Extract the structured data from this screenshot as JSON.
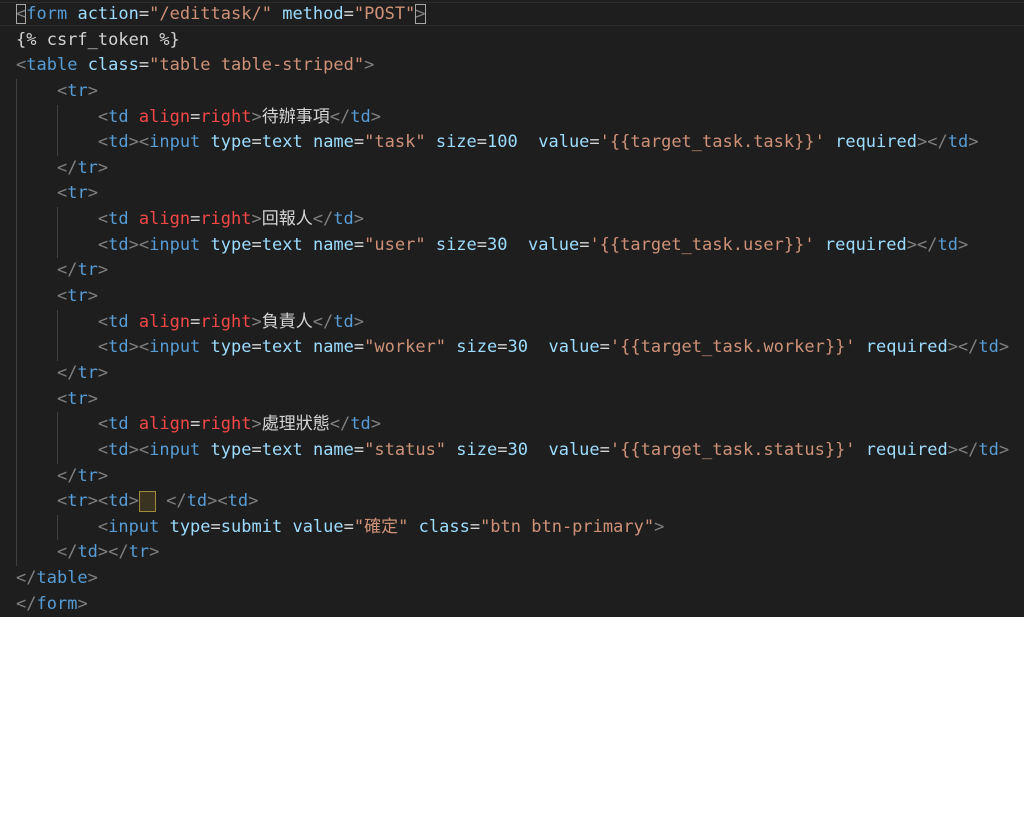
{
  "editor": {
    "lines": [
      [
        [
          "punct",
          "<"
        ],
        [
          "tag",
          "form"
        ],
        [
          "text",
          " "
        ],
        [
          "attr",
          "action"
        ],
        [
          "eq",
          "="
        ],
        [
          "str",
          "\"/edittask/\""
        ],
        [
          "text",
          " "
        ],
        [
          "attr",
          "method"
        ],
        [
          "eq",
          "="
        ],
        [
          "str",
          "\"POST\""
        ],
        [
          "punct",
          ">"
        ]
      ],
      [
        [
          "text",
          "{% csrf_token %}"
        ]
      ],
      [
        [
          "punct",
          "<"
        ],
        [
          "tag",
          "table"
        ],
        [
          "text",
          " "
        ],
        [
          "attr",
          "class"
        ],
        [
          "eq",
          "="
        ],
        [
          "str",
          "\"table table-striped\""
        ],
        [
          "punct",
          ">"
        ]
      ],
      [
        [
          "text",
          "    "
        ],
        [
          "punct",
          "<"
        ],
        [
          "tag",
          "tr"
        ],
        [
          "punct",
          ">"
        ]
      ],
      [
        [
          "text",
          "        "
        ],
        [
          "punct",
          "<"
        ],
        [
          "tag",
          "td"
        ],
        [
          "text",
          " "
        ],
        [
          "attrs",
          "align"
        ],
        [
          "eq",
          "="
        ],
        [
          "attrs",
          "right"
        ],
        [
          "punct",
          ">"
        ],
        [
          "text",
          "待辦事項"
        ],
        [
          "punct",
          "</"
        ],
        [
          "tag",
          "td"
        ],
        [
          "punct",
          ">"
        ]
      ],
      [
        [
          "text",
          "        "
        ],
        [
          "punct",
          "<"
        ],
        [
          "tag",
          "td"
        ],
        [
          "punct",
          "><"
        ],
        [
          "tag",
          "input"
        ],
        [
          "text",
          " "
        ],
        [
          "attr",
          "type"
        ],
        [
          "eq",
          "="
        ],
        [
          "attr",
          "text"
        ],
        [
          "text",
          " "
        ],
        [
          "attr",
          "name"
        ],
        [
          "eq",
          "="
        ],
        [
          "str",
          "\"task\""
        ],
        [
          "text",
          " "
        ],
        [
          "attr",
          "size"
        ],
        [
          "eq",
          "="
        ],
        [
          "attr",
          "100"
        ],
        [
          "text",
          "  "
        ],
        [
          "attr",
          "value"
        ],
        [
          "eq",
          "="
        ],
        [
          "str",
          "'{{target_task.task}}'"
        ],
        [
          "text",
          " "
        ],
        [
          "attr",
          "required"
        ],
        [
          "punct",
          "></"
        ],
        [
          "tag",
          "td"
        ],
        [
          "punct",
          ">"
        ]
      ],
      [
        [
          "text",
          "    "
        ],
        [
          "punct",
          "</"
        ],
        [
          "tag",
          "tr"
        ],
        [
          "punct",
          ">"
        ]
      ],
      [
        [
          "text",
          "    "
        ],
        [
          "punct",
          "<"
        ],
        [
          "tag",
          "tr"
        ],
        [
          "punct",
          ">"
        ]
      ],
      [
        [
          "text",
          "        "
        ],
        [
          "punct",
          "<"
        ],
        [
          "tag",
          "td"
        ],
        [
          "text",
          " "
        ],
        [
          "attrs",
          "align"
        ],
        [
          "eq",
          "="
        ],
        [
          "attrs",
          "right"
        ],
        [
          "punct",
          ">"
        ],
        [
          "text",
          "回報人"
        ],
        [
          "punct",
          "</"
        ],
        [
          "tag",
          "td"
        ],
        [
          "punct",
          ">"
        ]
      ],
      [
        [
          "text",
          "        "
        ],
        [
          "punct",
          "<"
        ],
        [
          "tag",
          "td"
        ],
        [
          "punct",
          "><"
        ],
        [
          "tag",
          "input"
        ],
        [
          "text",
          " "
        ],
        [
          "attr",
          "type"
        ],
        [
          "eq",
          "="
        ],
        [
          "attr",
          "text"
        ],
        [
          "text",
          " "
        ],
        [
          "attr",
          "name"
        ],
        [
          "eq",
          "="
        ],
        [
          "str",
          "\"user\""
        ],
        [
          "text",
          " "
        ],
        [
          "attr",
          "size"
        ],
        [
          "eq",
          "="
        ],
        [
          "attr",
          "30"
        ],
        [
          "text",
          "  "
        ],
        [
          "attr",
          "value"
        ],
        [
          "eq",
          "="
        ],
        [
          "str",
          "'{{target_task.user}}'"
        ],
        [
          "text",
          " "
        ],
        [
          "attr",
          "required"
        ],
        [
          "punct",
          "></"
        ],
        [
          "tag",
          "td"
        ],
        [
          "punct",
          ">"
        ]
      ],
      [
        [
          "text",
          "    "
        ],
        [
          "punct",
          "</"
        ],
        [
          "tag",
          "tr"
        ],
        [
          "punct",
          ">"
        ]
      ],
      [
        [
          "text",
          "    "
        ],
        [
          "punct",
          "<"
        ],
        [
          "tag",
          "tr"
        ],
        [
          "punct",
          ">"
        ]
      ],
      [
        [
          "text",
          "        "
        ],
        [
          "punct",
          "<"
        ],
        [
          "tag",
          "td"
        ],
        [
          "text",
          " "
        ],
        [
          "attrs",
          "align"
        ],
        [
          "eq",
          "="
        ],
        [
          "attrs",
          "right"
        ],
        [
          "punct",
          ">"
        ],
        [
          "text",
          "負責人"
        ],
        [
          "punct",
          "</"
        ],
        [
          "tag",
          "td"
        ],
        [
          "punct",
          ">"
        ]
      ],
      [
        [
          "text",
          "        "
        ],
        [
          "punct",
          "<"
        ],
        [
          "tag",
          "td"
        ],
        [
          "punct",
          "><"
        ],
        [
          "tag",
          "input"
        ],
        [
          "text",
          " "
        ],
        [
          "attr",
          "type"
        ],
        [
          "eq",
          "="
        ],
        [
          "attr",
          "text"
        ],
        [
          "text",
          " "
        ],
        [
          "attr",
          "name"
        ],
        [
          "eq",
          "="
        ],
        [
          "str",
          "\"worker\""
        ],
        [
          "text",
          " "
        ],
        [
          "attr",
          "size"
        ],
        [
          "eq",
          "="
        ],
        [
          "attr",
          "30"
        ],
        [
          "text",
          "  "
        ],
        [
          "attr",
          "value"
        ],
        [
          "eq",
          "="
        ],
        [
          "str",
          "'{{target_task.worker}}'"
        ],
        [
          "text",
          " "
        ],
        [
          "attr",
          "required"
        ],
        [
          "punct",
          "></"
        ],
        [
          "tag",
          "td"
        ],
        [
          "punct",
          ">"
        ]
      ],
      [
        [
          "text",
          "    "
        ],
        [
          "punct",
          "</"
        ],
        [
          "tag",
          "tr"
        ],
        [
          "punct",
          ">"
        ]
      ],
      [
        [
          "text",
          "    "
        ],
        [
          "punct",
          "<"
        ],
        [
          "tag",
          "tr"
        ],
        [
          "punct",
          ">"
        ]
      ],
      [
        [
          "text",
          "        "
        ],
        [
          "punct",
          "<"
        ],
        [
          "tag",
          "td"
        ],
        [
          "text",
          " "
        ],
        [
          "attrs",
          "align"
        ],
        [
          "eq",
          "="
        ],
        [
          "attrs",
          "right"
        ],
        [
          "punct",
          ">"
        ],
        [
          "text",
          "處理狀態"
        ],
        [
          "punct",
          "</"
        ],
        [
          "tag",
          "td"
        ],
        [
          "punct",
          ">"
        ]
      ],
      [
        [
          "text",
          "        "
        ],
        [
          "punct",
          "<"
        ],
        [
          "tag",
          "td"
        ],
        [
          "punct",
          "><"
        ],
        [
          "tag",
          "input"
        ],
        [
          "text",
          " "
        ],
        [
          "attr",
          "type"
        ],
        [
          "eq",
          "="
        ],
        [
          "attr",
          "text"
        ],
        [
          "text",
          " "
        ],
        [
          "attr",
          "name"
        ],
        [
          "eq",
          "="
        ],
        [
          "str",
          "\"status\""
        ],
        [
          "text",
          " "
        ],
        [
          "attr",
          "size"
        ],
        [
          "eq",
          "="
        ],
        [
          "attr",
          "30"
        ],
        [
          "text",
          "  "
        ],
        [
          "attr",
          "value"
        ],
        [
          "eq",
          "="
        ],
        [
          "str",
          "'{{target_task.status}}'"
        ],
        [
          "text",
          " "
        ],
        [
          "attr",
          "required"
        ],
        [
          "punct",
          "></"
        ],
        [
          "tag",
          "td"
        ],
        [
          "punct",
          ">"
        ]
      ],
      [
        [
          "text",
          "    "
        ],
        [
          "punct",
          "</"
        ],
        [
          "tag",
          "tr"
        ],
        [
          "punct",
          ">"
        ]
      ],
      [
        [
          "text",
          "    "
        ],
        [
          "punct",
          "<"
        ],
        [
          "tag",
          "tr"
        ],
        [
          "punct",
          "><"
        ],
        [
          "tag",
          "td"
        ],
        [
          "punct",
          ">"
        ],
        [
          "cursor",
          ""
        ],
        [
          "text",
          " "
        ],
        [
          "punct",
          "</"
        ],
        [
          "tag",
          "td"
        ],
        [
          "punct",
          "><"
        ],
        [
          "tag",
          "td"
        ],
        [
          "punct",
          ">"
        ]
      ],
      [
        [
          "text",
          "        "
        ],
        [
          "punct",
          "<"
        ],
        [
          "tag",
          "input"
        ],
        [
          "text",
          " "
        ],
        [
          "attr",
          "type"
        ],
        [
          "eq",
          "="
        ],
        [
          "attr",
          "submit"
        ],
        [
          "text",
          " "
        ],
        [
          "attr",
          "value"
        ],
        [
          "eq",
          "="
        ],
        [
          "str",
          "\"確定\""
        ],
        [
          "text",
          " "
        ],
        [
          "attr",
          "class"
        ],
        [
          "eq",
          "="
        ],
        [
          "str",
          "\"btn btn-primary\""
        ],
        [
          "punct",
          ">"
        ]
      ],
      [
        [
          "text",
          "    "
        ],
        [
          "punct",
          "</"
        ],
        [
          "tag",
          "td"
        ],
        [
          "punct",
          "></"
        ],
        [
          "tag",
          "tr"
        ],
        [
          "punct",
          ">"
        ]
      ],
      [
        [
          "punct",
          "</"
        ],
        [
          "tag",
          "table"
        ],
        [
          "punct",
          ">"
        ]
      ],
      [
        [
          "punct",
          "</"
        ],
        [
          "tag",
          "form"
        ],
        [
          "punct",
          ">"
        ]
      ]
    ]
  },
  "colors": {
    "background": "#1e1e1e",
    "tag": "#569cd6",
    "attribute": "#9cdcfe",
    "attribute_special": "#f44747",
    "string": "#ce9178",
    "text": "#d4d4d4",
    "punctuation": "#808080"
  }
}
